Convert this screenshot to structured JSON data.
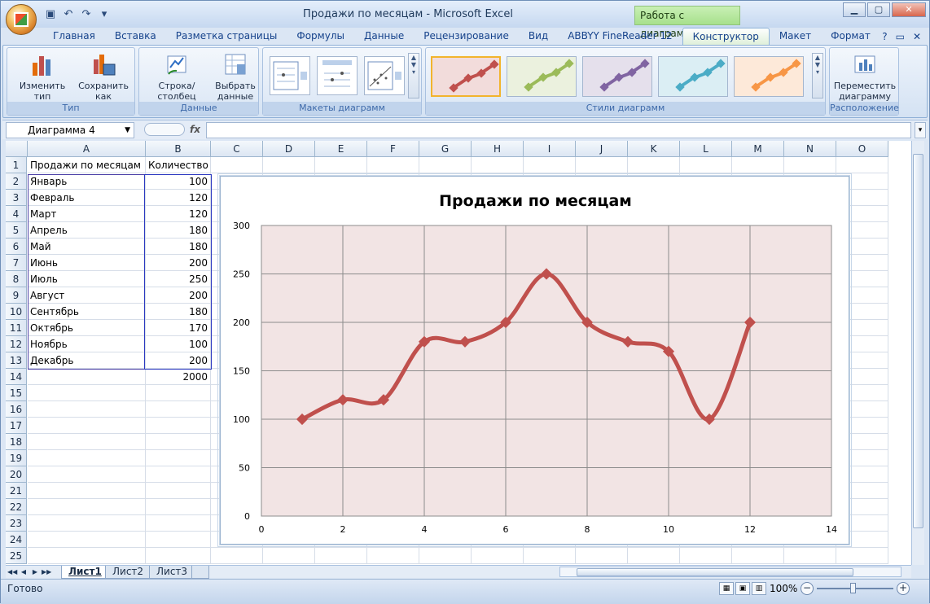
{
  "window": {
    "title": "Продажи по месяцам - Microsoft Excel",
    "context_title": "Работа с диаграммами"
  },
  "ribbon_tabs": [
    "Главная",
    "Вставка",
    "Разметка страницы",
    "Формулы",
    "Данные",
    "Рецензирование",
    "Вид",
    "ABBYY FineReader 12",
    "Конструктор",
    "Макет",
    "Формат"
  ],
  "active_tab": "Конструктор",
  "ribbon": {
    "type_group": {
      "label": "Тип",
      "change_type": "Изменить тип\nдиаграммы",
      "save_template": "Сохранить\nкак шаблон"
    },
    "data_group": {
      "label": "Данные",
      "switch_row_col": "Строка/столбец",
      "select_data": "Выбрать\nданные"
    },
    "layouts_group": {
      "label": "Макеты диаграмм"
    },
    "styles_group": {
      "label": "Стили диаграмм",
      "styles": [
        "#c0504d",
        "#9bbb59",
        "#8064a2",
        "#4bacc6",
        "#f79646"
      ],
      "style_bgs": [
        "#f2dcdb",
        "#ebf1de",
        "#e5e0ec",
        "#dbeef4",
        "#fde9d9"
      ]
    },
    "location_group": {
      "label": "Расположение",
      "move_chart": "Переместить\nдиаграмму"
    }
  },
  "formula_bar": {
    "name_box": "Диаграмма 4",
    "fx": "fx",
    "value": ""
  },
  "columns": [
    "A",
    "B",
    "C",
    "D",
    "E",
    "F",
    "G",
    "H",
    "I",
    "J",
    "K",
    "L",
    "M",
    "N",
    "O"
  ],
  "rows": [
    "1",
    "2",
    "3",
    "4",
    "5",
    "6",
    "7",
    "8",
    "9",
    "10",
    "11",
    "12",
    "13",
    "14",
    "15",
    "16",
    "17",
    "18",
    "19",
    "20",
    "21",
    "22",
    "23",
    "24",
    "25"
  ],
  "table": {
    "header_a": "Продажи по месяцам",
    "header_b": "Количество",
    "months": [
      "Январь",
      "Февраль",
      "Март",
      "Апрель",
      "Май",
      "Июнь",
      "Июль",
      "Август",
      "Сентябрь",
      "Октябрь",
      "Ноябрь",
      "Декабрь"
    ],
    "quantities": [
      "100",
      "120",
      "120",
      "180",
      "180",
      "200",
      "250",
      "200",
      "180",
      "170",
      "100",
      "200"
    ],
    "total": "2000"
  },
  "chart_data": {
    "type": "scatter",
    "title": "Продажи по месяцам",
    "xlabel": "",
    "ylabel": "",
    "x": [
      1,
      2,
      3,
      4,
      5,
      6,
      7,
      8,
      9,
      10,
      11,
      12
    ],
    "y": [
      100,
      120,
      120,
      180,
      180,
      200,
      250,
      200,
      180,
      170,
      100,
      200
    ],
    "xlim": [
      0,
      14
    ],
    "ylim": [
      0,
      300
    ],
    "xticks": [
      "0",
      "2",
      "4",
      "6",
      "8",
      "10",
      "12",
      "14"
    ],
    "yticks": [
      "0",
      "50",
      "100",
      "150",
      "200",
      "250",
      "300"
    ],
    "smooth": true,
    "grid": true,
    "line_color": "#c0504d",
    "plot_bg": "#f2e4e4"
  },
  "sheet_tabs": [
    "Лист1",
    "Лист2",
    "Лист3"
  ],
  "active_sheet": "Лист1",
  "status": {
    "ready": "Готово",
    "zoom": "100%"
  }
}
